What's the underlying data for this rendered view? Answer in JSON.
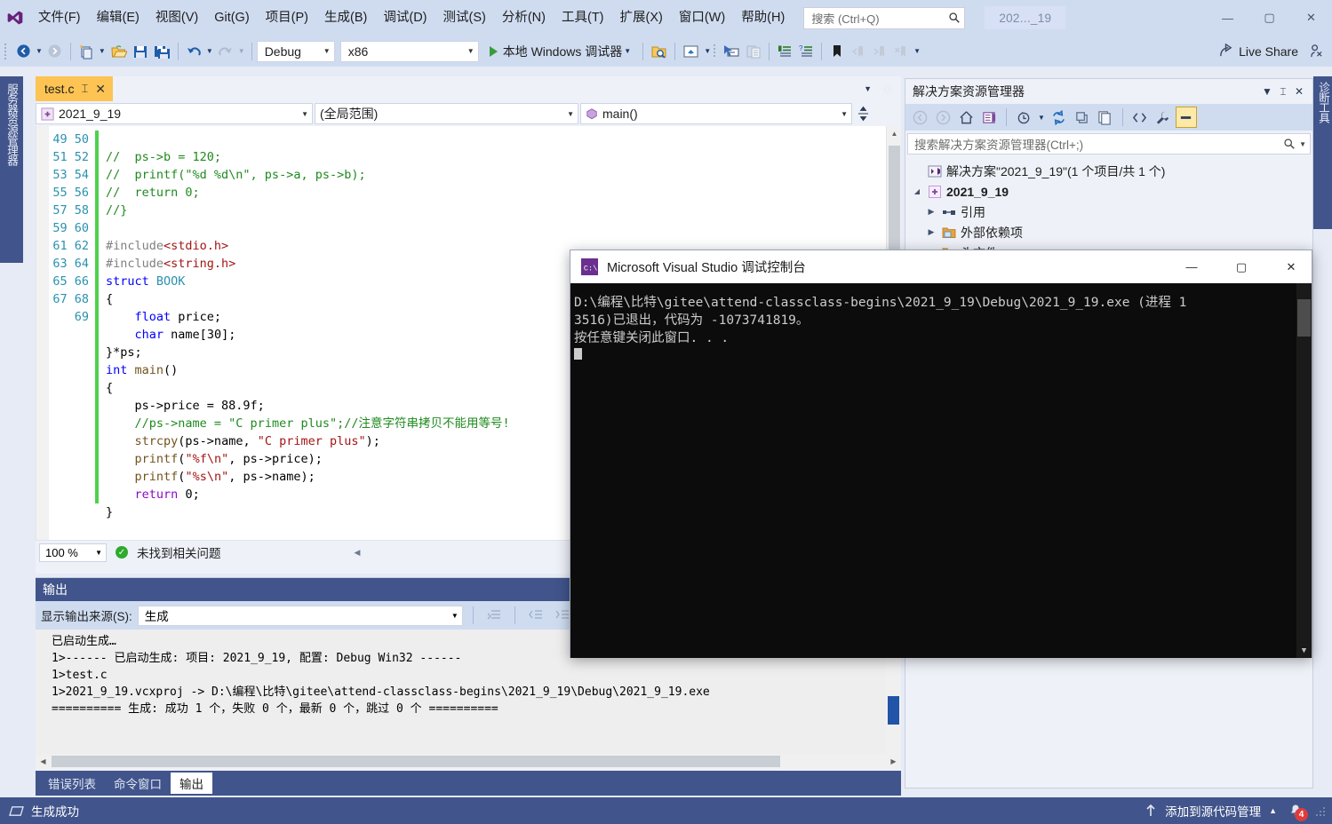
{
  "titlebar": {
    "menu_items": [
      "文件(F)",
      "编辑(E)",
      "视图(V)",
      "Git(G)",
      "项目(P)",
      "生成(B)",
      "调试(D)",
      "测试(S)",
      "分析(N)",
      "工具(T)",
      "扩展(X)",
      "窗口(W)",
      "帮助(H)"
    ],
    "search_placeholder": "搜索 (Ctrl+Q)",
    "window_title": "202..._19",
    "minimize": "—",
    "maximize": "▢",
    "close": "✕"
  },
  "toolbar": {
    "configuration": "Debug",
    "platform": "x86",
    "run_label": "本地 Windows 调试器",
    "live_share": "Live Share"
  },
  "docks": {
    "left_label": "服务器资源管理器",
    "right_label": "诊断工具"
  },
  "editor": {
    "tab_title": "test.c",
    "tab_pin": "⌶",
    "tab_close": "✕",
    "nav_project": "2021_9_19",
    "nav_scope": "(全局范围)",
    "nav_member": "main()",
    "first_line_number": 49,
    "lines": [
      "//  ps->b = 120;",
      "//  printf(\"%d %d\\n\", ps->a, ps->b);",
      "//  return 0;",
      "//}",
      "",
      "#include<stdio.h>",
      "#include<string.h>",
      "struct BOOK",
      "{",
      "    float price;",
      "    char name[30];",
      "}*ps;",
      "int main()",
      "{",
      "    ps->price = 88.9f;",
      "    //ps->name = \"C primer plus\";//注意字符串拷贝不能用等号!",
      "    strcpy(ps->name, \"C primer plus\");",
      "    printf(\"%f\\n\", ps->price);",
      "    printf(\"%s\\n\", ps->name);",
      "    return 0;",
      "}"
    ],
    "zoom": "100 %",
    "problem_status": "未找到相关问题"
  },
  "output": {
    "title": "输出",
    "source_label": "显示输出来源(S):",
    "source_value": "生成",
    "lines": [
      "已启动生成…",
      "1>------ 已启动生成: 项目: 2021_9_19, 配置: Debug Win32 ------",
      "1>test.c",
      "1>2021_9_19.vcxproj -> D:\\编程\\比特\\gitee\\attend-classclass-begins\\2021_9_19\\Debug\\2021_9_19.exe",
      "========== 生成: 成功 1 个，失败 0 个，最新 0 个，跳过 0 个 =========="
    ],
    "tabs": [
      {
        "label": "错误列表",
        "active": false
      },
      {
        "label": "命令窗口",
        "active": false
      },
      {
        "label": "输出",
        "active": true
      }
    ]
  },
  "solution_explorer": {
    "title": "解决方案资源管理器",
    "search_placeholder": "搜索解决方案资源管理器(Ctrl+;)",
    "tree": [
      {
        "label": "解决方案\"2021_9_19\"(1 个项目/共 1 个)",
        "level": 0,
        "expander": "",
        "bold": false,
        "icon": "solution-icon"
      },
      {
        "label": "2021_9_19",
        "level": 0,
        "expander": "▲",
        "bold": true,
        "icon": "project-icon"
      },
      {
        "label": "引用",
        "level": 1,
        "expander": "▶",
        "bold": false,
        "icon": "references-icon"
      },
      {
        "label": "外部依赖项",
        "level": 1,
        "expander": "▶",
        "bold": false,
        "icon": "folder-icon"
      },
      {
        "label": "头文件",
        "level": 1,
        "expander": "▶",
        "bold": false,
        "icon": "folder-icon"
      }
    ]
  },
  "console": {
    "title": "Microsoft Visual Studio 调试控制台",
    "minimize": "—",
    "maximize": "▢",
    "close": "✕",
    "line1": "D:\\编程\\比特\\gitee\\attend-classclass-begins\\2021_9_19\\Debug\\2021_9_19.exe (进程 1",
    "line2": "3516)已退出，代码为 -1073741819。",
    "line3": "按任意键关闭此窗口. . ."
  },
  "statusbar": {
    "build_status": "生成成功",
    "source_control": "添加到源代码管理",
    "notification_count": "4"
  },
  "colors": {
    "accent_blue": "#41548b",
    "toolbar_blue": "#cfdcf0",
    "tab_active": "#fdc453",
    "success_green": "#2cab2c",
    "badge_red": "#e03b3b"
  }
}
